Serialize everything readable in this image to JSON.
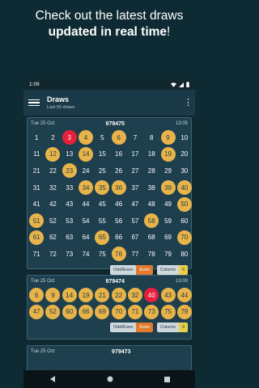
{
  "promo": {
    "line1": "Check out the latest draws",
    "line2": "updated in real time",
    "line2_suffix": "!"
  },
  "status": {
    "time": "1:09"
  },
  "appbar": {
    "title": "Draws",
    "subtitle": "Last 50 draws"
  },
  "draws": [
    {
      "date": "Tue 25 Oct",
      "number": "979475",
      "time": "13:05",
      "grid": [
        {
          "n": "1",
          "s": ""
        },
        {
          "n": "2",
          "s": ""
        },
        {
          "n": "3",
          "s": "red"
        },
        {
          "n": "4",
          "s": "hit"
        },
        {
          "n": "5",
          "s": ""
        },
        {
          "n": "6",
          "s": "hit"
        },
        {
          "n": "7",
          "s": ""
        },
        {
          "n": "8",
          "s": ""
        },
        {
          "n": "9",
          "s": "hit"
        },
        {
          "n": "10",
          "s": ""
        },
        {
          "n": "11",
          "s": ""
        },
        {
          "n": "12",
          "s": "hit"
        },
        {
          "n": "13",
          "s": ""
        },
        {
          "n": "14",
          "s": "hit"
        },
        {
          "n": "15",
          "s": ""
        },
        {
          "n": "16",
          "s": ""
        },
        {
          "n": "17",
          "s": ""
        },
        {
          "n": "18",
          "s": ""
        },
        {
          "n": "19",
          "s": "hit"
        },
        {
          "n": "20",
          "s": ""
        },
        {
          "n": "21",
          "s": ""
        },
        {
          "n": "22",
          "s": ""
        },
        {
          "n": "23",
          "s": "hit"
        },
        {
          "n": "24",
          "s": ""
        },
        {
          "n": "25",
          "s": ""
        },
        {
          "n": "26",
          "s": ""
        },
        {
          "n": "27",
          "s": ""
        },
        {
          "n": "28",
          "s": ""
        },
        {
          "n": "29",
          "s": ""
        },
        {
          "n": "30",
          "s": ""
        },
        {
          "n": "31",
          "s": ""
        },
        {
          "n": "32",
          "s": ""
        },
        {
          "n": "33",
          "s": ""
        },
        {
          "n": "34",
          "s": "hit"
        },
        {
          "n": "35",
          "s": "hit"
        },
        {
          "n": "36",
          "s": "hit"
        },
        {
          "n": "37",
          "s": ""
        },
        {
          "n": "38",
          "s": ""
        },
        {
          "n": "39",
          "s": "hit"
        },
        {
          "n": "40",
          "s": "hit"
        },
        {
          "n": "41",
          "s": ""
        },
        {
          "n": "42",
          "s": ""
        },
        {
          "n": "43",
          "s": ""
        },
        {
          "n": "44",
          "s": ""
        },
        {
          "n": "45",
          "s": ""
        },
        {
          "n": "46",
          "s": ""
        },
        {
          "n": "47",
          "s": ""
        },
        {
          "n": "48",
          "s": ""
        },
        {
          "n": "49",
          "s": ""
        },
        {
          "n": "50",
          "s": "hit"
        },
        {
          "n": "51",
          "s": "hit"
        },
        {
          "n": "52",
          "s": ""
        },
        {
          "n": "53",
          "s": ""
        },
        {
          "n": "54",
          "s": ""
        },
        {
          "n": "55",
          "s": ""
        },
        {
          "n": "56",
          "s": ""
        },
        {
          "n": "57",
          "s": ""
        },
        {
          "n": "58",
          "s": "hit"
        },
        {
          "n": "59",
          "s": ""
        },
        {
          "n": "60",
          "s": ""
        },
        {
          "n": "61",
          "s": "hit"
        },
        {
          "n": "62",
          "s": ""
        },
        {
          "n": "63",
          "s": ""
        },
        {
          "n": "64",
          "s": ""
        },
        {
          "n": "65",
          "s": "hit"
        },
        {
          "n": "66",
          "s": ""
        },
        {
          "n": "67",
          "s": ""
        },
        {
          "n": "68",
          "s": ""
        },
        {
          "n": "69",
          "s": ""
        },
        {
          "n": "70",
          "s": "hit"
        },
        {
          "n": "71",
          "s": ""
        },
        {
          "n": "72",
          "s": ""
        },
        {
          "n": "73",
          "s": ""
        },
        {
          "n": "74",
          "s": ""
        },
        {
          "n": "75",
          "s": ""
        },
        {
          "n": "76",
          "s": "hit"
        },
        {
          "n": "77",
          "s": ""
        },
        {
          "n": "78",
          "s": ""
        },
        {
          "n": "79",
          "s": ""
        },
        {
          "n": "80",
          "s": ""
        }
      ],
      "odd_even_label": "Odd/Even",
      "odd_even_value": "Even",
      "column_label": "Column",
      "column_value": "6"
    },
    {
      "date": "Tue 25 Oct",
      "number": "979474",
      "time": "13:00",
      "grid": [
        {
          "n": "6",
          "s": "hit"
        },
        {
          "n": "9",
          "s": "hit"
        },
        {
          "n": "14",
          "s": "hit"
        },
        {
          "n": "19",
          "s": "hit"
        },
        {
          "n": "21",
          "s": "hit"
        },
        {
          "n": "22",
          "s": "hit"
        },
        {
          "n": "32",
          "s": "hit"
        },
        {
          "n": "40",
          "s": "red"
        },
        {
          "n": "43",
          "s": "hit"
        },
        {
          "n": "44",
          "s": "hit"
        },
        {
          "n": "47",
          "s": "hit"
        },
        {
          "n": "52",
          "s": "hit"
        },
        {
          "n": "60",
          "s": "hit"
        },
        {
          "n": "66",
          "s": "hit"
        },
        {
          "n": "69",
          "s": "hit"
        },
        {
          "n": "70",
          "s": "hit"
        },
        {
          "n": "71",
          "s": "hit"
        },
        {
          "n": "73",
          "s": "hit"
        },
        {
          "n": "75",
          "s": "hit"
        },
        {
          "n": "79",
          "s": "hit"
        }
      ],
      "odd_even_label": "Odd/Even",
      "odd_even_value": "Even",
      "column_label": "Column",
      "column_value": "9"
    },
    {
      "date": "Tue 25 Oct",
      "number": "979473",
      "time": ""
    }
  ],
  "colors": {
    "accent": "#e8b44a",
    "last": "#e6203a",
    "fab": "#1bbf8f",
    "header": "#1b3a47"
  }
}
